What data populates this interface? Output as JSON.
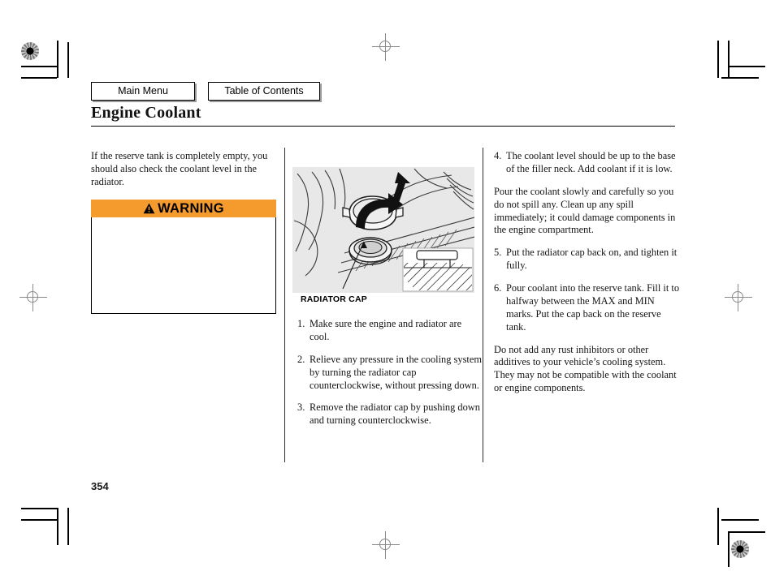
{
  "nav": {
    "main_menu": "Main Menu",
    "table_of_contents": "Table of Contents"
  },
  "header": {
    "title": "Engine Coolant"
  },
  "page_number": "354",
  "left_column": {
    "intro": "If the reserve tank is completely empty, you should also check the coolant level in the radiator.",
    "warning": {
      "label": "WARNING",
      "icon": "warning-triangle-icon",
      "body": "",
      "accent_color": "#F59B2E"
    }
  },
  "figure": {
    "caption": "RADIATOR CAP",
    "background_color": "#e8e8e8",
    "description": "radiator-cap-removal-illustration"
  },
  "steps": [
    {
      "num": "1.",
      "text": "Make sure the engine and radiator are cool."
    },
    {
      "num": "2.",
      "text": "Relieve any pressure in the cooling system by turning the radiator cap counterclockwise, without pressing down."
    },
    {
      "num": "3.",
      "text": "Remove the radiator cap by pushing down and turning counterclockwise."
    },
    {
      "num": "4.",
      "text": "The coolant level should be up to the base of the filler neck. Add coolant if it is low."
    },
    {
      "num": "5.",
      "text": "Put the radiator cap back on, and tighten it fully."
    },
    {
      "num": "6.",
      "text": "Pour coolant into the reserve tank. Fill it to halfway between the MAX and MIN marks. Put the cap back on the reserve tank."
    }
  ],
  "right_column": {
    "step4_note": "Pour the coolant slowly and carefully so you do not spill any. Clean up any spill immediately; it could damage components in the engine compartment.",
    "closing_note": "Do not add any rust inhibitors or other additives to your vehicle’s cooling system. They may not be compatible with the coolant or engine components."
  }
}
